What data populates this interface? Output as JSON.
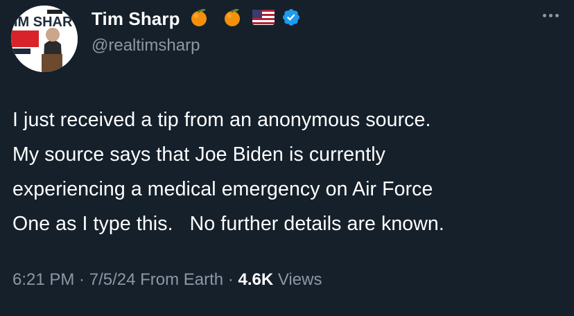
{
  "author": {
    "display_name": "Tim Sharp",
    "handle": "@realtimsharp",
    "name_emojis": [
      "orange-emoji",
      "orange-emoji",
      "us-flag-emoji"
    ],
    "verified": true,
    "avatar_sign_text": "IM SHAR"
  },
  "tweet": {
    "lines": [
      "I just received a tip from an anonymous source.",
      "My source says that Joe Biden is currently",
      "experiencing a medical emergency on Air Force",
      "One as I type this.   No further details are known."
    ]
  },
  "meta": {
    "time": "6:21 PM",
    "separator": " · ",
    "date": "7/5/24",
    "source": "From Earth",
    "views_count": "4.6K",
    "views_label": "Views"
  },
  "colors": {
    "background": "#15202b",
    "primary_text": "#ffffff",
    "secondary_text": "#8b98a5",
    "verified_blue": "#1d9bf0"
  }
}
